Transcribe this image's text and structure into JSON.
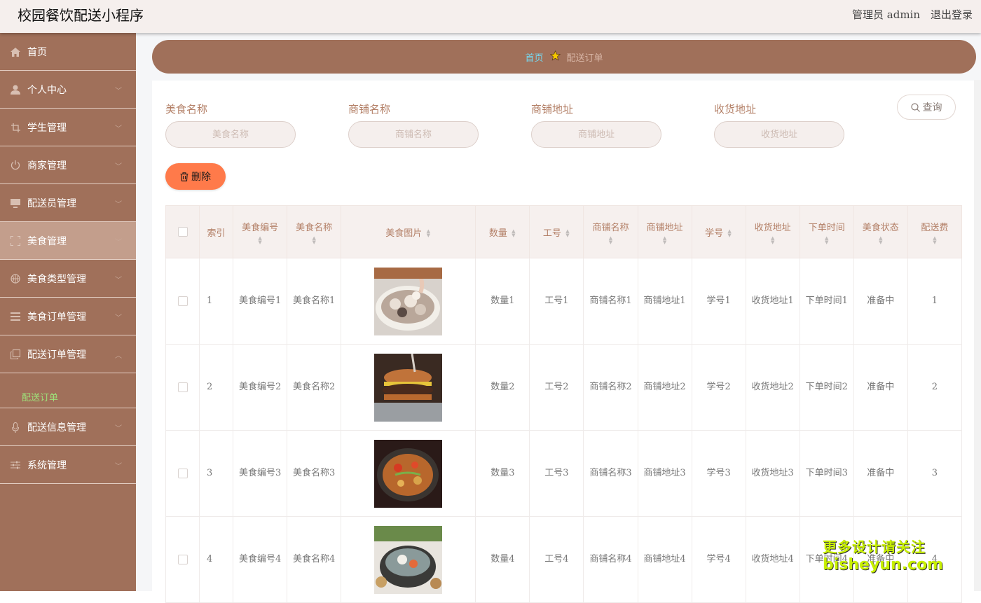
{
  "app": {
    "title": "校园餐饮配送小程序",
    "user": "管理员 admin",
    "logout": "退出登录"
  },
  "sidebar": {
    "items": [
      {
        "label": "首页",
        "icon": "home-icon"
      },
      {
        "label": "个人中心",
        "icon": "user-icon"
      },
      {
        "label": "学生管理",
        "icon": "crop-icon"
      },
      {
        "label": "商家管理",
        "icon": "power-icon"
      },
      {
        "label": "配送员管理",
        "icon": "monitor-icon"
      },
      {
        "label": "美食管理",
        "icon": "frame-icon"
      },
      {
        "label": "美食类型管理",
        "icon": "basketball-icon"
      },
      {
        "label": "美食订单管理",
        "icon": "list-icon"
      },
      {
        "label": "配送订单管理",
        "icon": "copy-icon"
      },
      {
        "label": "配送信息管理",
        "icon": "mic-icon"
      },
      {
        "label": "系统管理",
        "icon": "sliders-icon"
      }
    ],
    "sub_item": "配送订单"
  },
  "breadcrumb": {
    "home": "首页",
    "current": "配送订单"
  },
  "search": {
    "fields": [
      {
        "label": "美食名称",
        "placeholder": "美食名称"
      },
      {
        "label": "商铺名称",
        "placeholder": "商铺名称"
      },
      {
        "label": "商铺地址",
        "placeholder": "商铺地址"
      },
      {
        "label": "收货地址",
        "placeholder": "收货地址"
      }
    ],
    "query_label": "查询"
  },
  "actions": {
    "delete_label": "删除"
  },
  "table": {
    "headers": {
      "index": "索引",
      "code": "美食编号",
      "name": "美食名称",
      "image": "美食图片",
      "qty": "数量",
      "worker": "工号",
      "shop": "商铺名称",
      "shop_addr": "商铺地址",
      "student": "学号",
      "addr": "收货地址",
      "time": "下单时间",
      "status": "美食状态",
      "fee": "配送费"
    },
    "rows": [
      {
        "index": "1",
        "code": "美食编号1",
        "name": "美食名称1",
        "qty": "数量1",
        "worker": "工号1",
        "shop": "商铺名称1",
        "shop_addr": "商铺地址1",
        "student": "学号1",
        "addr": "收货地址1",
        "time": "下单时间1",
        "status": "准备中",
        "fee": "1"
      },
      {
        "index": "2",
        "code": "美食编号2",
        "name": "美食名称2",
        "qty": "数量2",
        "worker": "工号2",
        "shop": "商铺名称2",
        "shop_addr": "商铺地址2",
        "student": "学号2",
        "addr": "收货地址2",
        "time": "下单时间2",
        "status": "准备中",
        "fee": "2"
      },
      {
        "index": "3",
        "code": "美食编号3",
        "name": "美食名称3",
        "qty": "数量3",
        "worker": "工号3",
        "shop": "商铺名称3",
        "shop_addr": "商铺地址3",
        "student": "学号3",
        "addr": "收货地址3",
        "time": "下单时间3",
        "status": "准备中",
        "fee": "3"
      },
      {
        "index": "4",
        "code": "美食编号4",
        "name": "美食名称4",
        "qty": "数量4",
        "worker": "工号4",
        "shop": "商铺名称4",
        "shop_addr": "商铺地址4",
        "student": "学号4",
        "addr": "收货地址4",
        "time": "下单时间4",
        "status": "准备中",
        "fee": "4"
      }
    ]
  },
  "watermark": {
    "line1": "更多设计请关注",
    "line2": "bisheyun.com"
  },
  "colors": {
    "sidebar": "#a0705a",
    "accent": "#ff7a4a",
    "label": "#b37f66",
    "active_sub": "#9ee27a"
  }
}
